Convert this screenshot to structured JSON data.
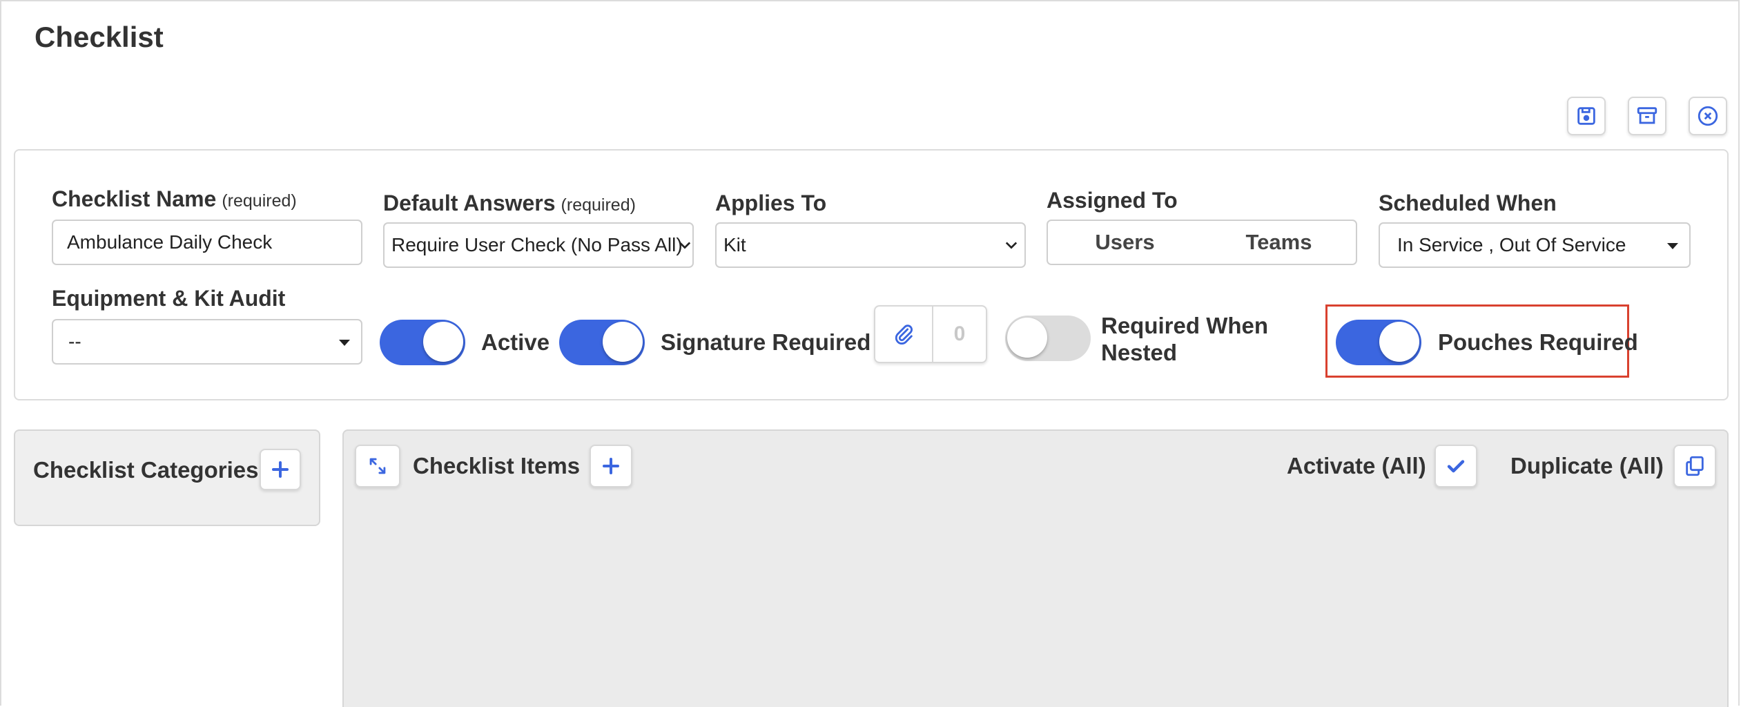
{
  "page": {
    "title": "Checklist"
  },
  "toolbar": {
    "save_icon": "save-icon",
    "archive_icon": "archive-icon",
    "close_icon": "close-circle-icon"
  },
  "form": {
    "checklist_name": {
      "label": "Checklist Name",
      "required_note": "(required)",
      "value": "Ambulance Daily Check"
    },
    "default_answers": {
      "label": "Default Answers",
      "required_note": "(required)",
      "value": "Require User Check (No Pass All)"
    },
    "applies_to": {
      "label": "Applies To",
      "value": "Kit"
    },
    "assigned_to": {
      "label": "Assigned To",
      "options": [
        "Users",
        "Teams"
      ]
    },
    "scheduled_when": {
      "label": "Scheduled When",
      "value": "In Service , Out Of Service"
    },
    "equipment_kit_audit": {
      "label": "Equipment & Kit Audit",
      "value": "--"
    },
    "toggles": {
      "active": {
        "label": "Active",
        "on": true
      },
      "signature_required": {
        "label": "Signature Required",
        "on": true
      },
      "required_when_nested": {
        "label_line1": "Required When",
        "label_line2": "Nested",
        "on": false
      },
      "pouches_required": {
        "label": "Pouches Required",
        "on": true
      }
    },
    "attachments": {
      "count": "0"
    }
  },
  "categories": {
    "title": "Checklist Categories"
  },
  "items": {
    "title": "Checklist Items",
    "activate_all_label": "Activate (All)",
    "duplicate_all_label": "Duplicate (All)"
  },
  "colors": {
    "accent": "#3b66e0",
    "highlight": "#d9412f",
    "panel_bg": "#ebebeb"
  }
}
